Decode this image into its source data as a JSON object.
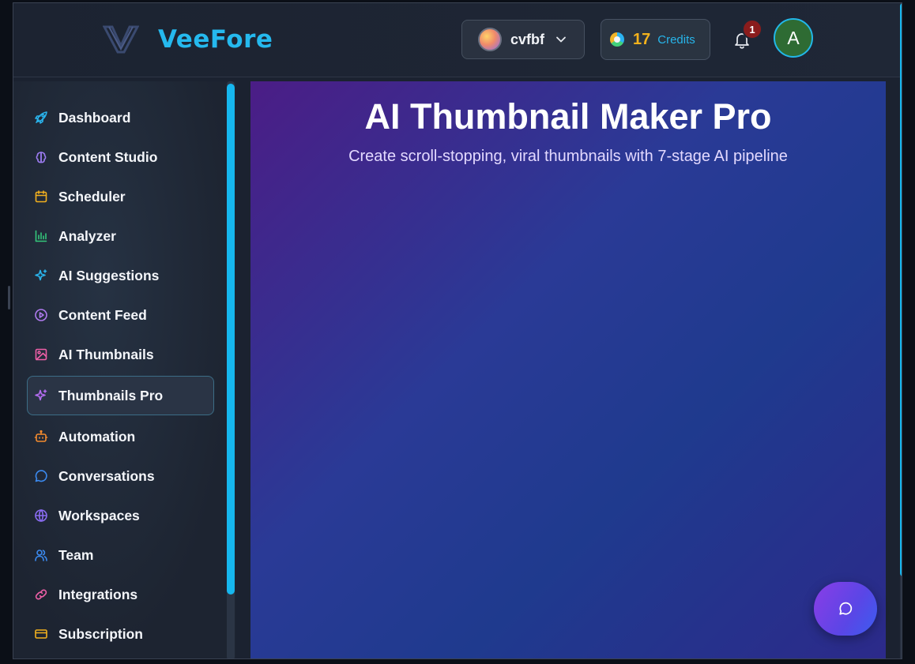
{
  "header": {
    "logo_text": "VeeFore",
    "workspace": {
      "name": "cvfbf"
    },
    "credits": {
      "count": "17",
      "label": "Credits"
    },
    "notifications": {
      "badge": "1"
    },
    "user": {
      "initial": "A"
    }
  },
  "sidebar": {
    "items": [
      {
        "label": "Dashboard",
        "icon": "rocket-icon",
        "color": "#2ab5ee"
      },
      {
        "label": "Content Studio",
        "icon": "brain-icon",
        "color": "#9b7bf0"
      },
      {
        "label": "Scheduler",
        "icon": "calendar-icon",
        "color": "#f2b01e"
      },
      {
        "label": "Analyzer",
        "icon": "bar-chart-icon",
        "color": "#34c77b"
      },
      {
        "label": "AI Suggestions",
        "icon": "sparkles-icon",
        "color": "#2ab5ee"
      },
      {
        "label": "Content Feed",
        "icon": "play-circle-icon",
        "color": "#b07bf0"
      },
      {
        "label": "AI Thumbnails",
        "icon": "image-icon",
        "color": "#ee5fa7"
      },
      {
        "label": "Thumbnails Pro",
        "icon": "sparkles-icon",
        "color": "#b56cf2",
        "active": true
      },
      {
        "label": "Automation",
        "icon": "bot-icon",
        "color": "#f28a2e"
      },
      {
        "label": "Conversations",
        "icon": "message-circle-icon",
        "color": "#3b8af0"
      },
      {
        "label": "Workspaces",
        "icon": "globe-icon",
        "color": "#8a6cf2"
      },
      {
        "label": "Team",
        "icon": "users-icon",
        "color": "#3b8af0"
      },
      {
        "label": "Integrations",
        "icon": "link-icon",
        "color": "#ee5fa7"
      },
      {
        "label": "Subscription",
        "icon": "credit-card-icon",
        "color": "#f2b01e"
      }
    ]
  },
  "main": {
    "title": "AI Thumbnail Maker Pro",
    "subtitle": "Create scroll-stopping, viral thumbnails with 7-stage AI pipeline"
  },
  "colors": {
    "accent": "#16b7ef",
    "credits_number": "#f3b21c",
    "badge": "#8a1c1c"
  }
}
